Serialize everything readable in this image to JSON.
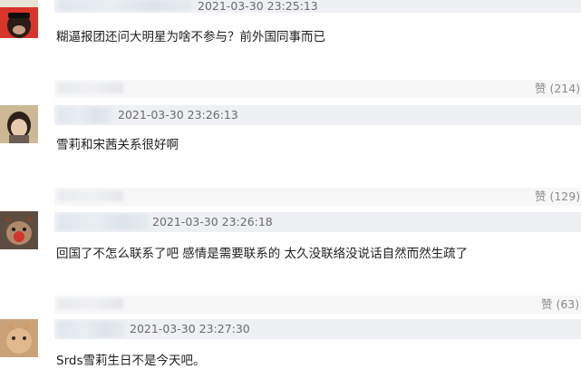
{
  "comments": [
    {
      "timestamp": "2021-03-30 23:25:13",
      "text": "糊逼报团还问大明星为啥不参与？前外国同事而已",
      "likes": "赞 (214)"
    },
    {
      "timestamp": "2021-03-30 23:26:13",
      "text": "雪莉和宋茜关系很好啊",
      "likes": "赞 (129)"
    },
    {
      "timestamp": "2021-03-30 23:26:18",
      "text": "回国了不怎么联系了吧 感情是需要联系的 太久没联络没说话自然而然生疏了",
      "likes": "赞 (63)"
    },
    {
      "timestamp": "2021-03-30 23:27:30",
      "text": "Srds雪莉生日不是今天吧。"
    }
  ]
}
